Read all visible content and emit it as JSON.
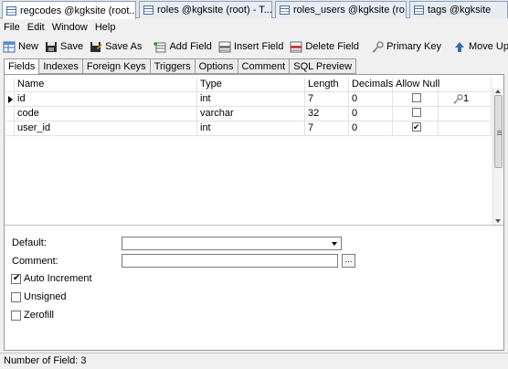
{
  "doc_tabs": [
    {
      "label": "regcodes @kgksite (root...",
      "active": true,
      "closable": true
    },
    {
      "label": "roles @kgksite (root) - T...",
      "active": false,
      "closable": false
    },
    {
      "label": "roles_users @kgksite (ro...",
      "active": false,
      "closable": false
    },
    {
      "label": "tags @kgksite",
      "active": false,
      "closable": false
    }
  ],
  "close_glyph": "×",
  "menu": [
    "File",
    "Edit",
    "Window",
    "Help"
  ],
  "toolbar": {
    "new": "New",
    "save": "Save",
    "save_as": "Save As",
    "add_field": "Add Field",
    "insert_field": "Insert Field",
    "delete_field": "Delete Field",
    "primary_key": "Primary Key",
    "move_up": "Move Up"
  },
  "prop_tabs": [
    "Fields",
    "Indexes",
    "Foreign Keys",
    "Triggers",
    "Options",
    "Comment",
    "SQL Preview"
  ],
  "grid": {
    "headers": {
      "name": "Name",
      "type": "Type",
      "length": "Length",
      "decimals": "Decimals",
      "allow_null": "Allow Null"
    },
    "rows": [
      {
        "name": "id",
        "type": "int",
        "length": "7",
        "decimals": "0",
        "allow_null": false,
        "key": "1",
        "current": true
      },
      {
        "name": "code",
        "type": "varchar",
        "length": "32",
        "decimals": "0",
        "allow_null": false,
        "key": "",
        "current": false
      },
      {
        "name": "user_id",
        "type": "int",
        "length": "7",
        "decimals": "0",
        "allow_null": true,
        "key": "",
        "current": false
      }
    ]
  },
  "form": {
    "default_label": "Default:",
    "default_value": "",
    "comment_label": "Comment:",
    "comment_value": "",
    "ellipsis": "...",
    "auto_increment": {
      "label": "Auto Increment",
      "checked": true
    },
    "unsigned": {
      "label": "Unsigned",
      "checked": false
    },
    "zerofill": {
      "label": "Zerofill",
      "checked": false
    }
  },
  "status": "Number of Field: 3",
  "colors": {
    "tab_bar": "#dfe6ef",
    "panel": "#ffffff",
    "chrome": "#f0f0f0"
  }
}
